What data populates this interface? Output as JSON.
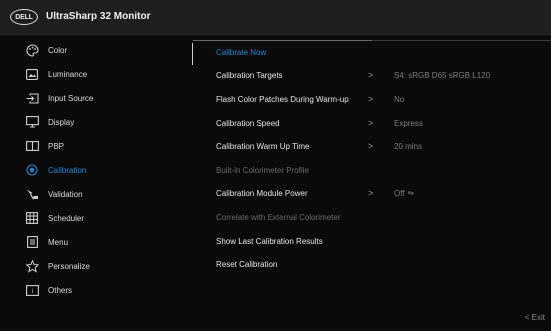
{
  "header": {
    "logo_text": "DELL",
    "title": "UltraSharp 32 Monitor"
  },
  "sidebar": {
    "items": [
      {
        "label": "Color",
        "icon": "color-palette-icon",
        "active": false
      },
      {
        "label": "Luminance",
        "icon": "luminance-icon",
        "active": false
      },
      {
        "label": "Input Source",
        "icon": "input-source-icon",
        "active": false
      },
      {
        "label": "Display",
        "icon": "display-icon",
        "active": false
      },
      {
        "label": "PBP",
        "icon": "pbp-icon",
        "active": false
      },
      {
        "label": "Calibration",
        "icon": "calibration-icon",
        "active": true
      },
      {
        "label": "Validation",
        "icon": "validation-icon",
        "active": false
      },
      {
        "label": "Scheduler",
        "icon": "scheduler-icon",
        "active": false
      },
      {
        "label": "Menu",
        "icon": "menu-icon",
        "active": false
      },
      {
        "label": "Personalize",
        "icon": "star-icon",
        "active": false
      },
      {
        "label": "Others",
        "icon": "others-icon",
        "active": false
      }
    ]
  },
  "main": {
    "rows": [
      {
        "label": "Calibrate Now",
        "value": "",
        "chevron": false,
        "state": "active"
      },
      {
        "label": "Calibration Targets",
        "value": "S4: sRGB D65 sRGB L120",
        "chevron": true,
        "state": "normal"
      },
      {
        "label": "Flash Color Patches During Warm-up",
        "value": "No",
        "chevron": true,
        "state": "normal"
      },
      {
        "label": "Calibration Speed",
        "value": "Express",
        "chevron": true,
        "state": "normal"
      },
      {
        "label": "Calibration Warm Up Time",
        "value": "20 mins",
        "chevron": true,
        "state": "normal"
      },
      {
        "label": "Built-in Colorimeter Profile",
        "value": "",
        "chevron": false,
        "state": "disabled"
      },
      {
        "label": "Calibration Module Power",
        "value": "Off",
        "chevron": true,
        "state": "normal"
      },
      {
        "label": "Correlate with External Colorimeter",
        "value": "",
        "chevron": false,
        "state": "disabled"
      },
      {
        "label": "Show Last Calibration Results",
        "value": "",
        "chevron": false,
        "state": "normal"
      },
      {
        "label": "Reset Calibration",
        "value": "",
        "chevron": false,
        "state": "normal"
      }
    ]
  },
  "footer": {
    "exit_label": "Exit",
    "exit_glyph": "<"
  },
  "colors": {
    "accent": "#1e8ad6",
    "background": "#0a0a0a",
    "header": "#1e1e1e"
  }
}
